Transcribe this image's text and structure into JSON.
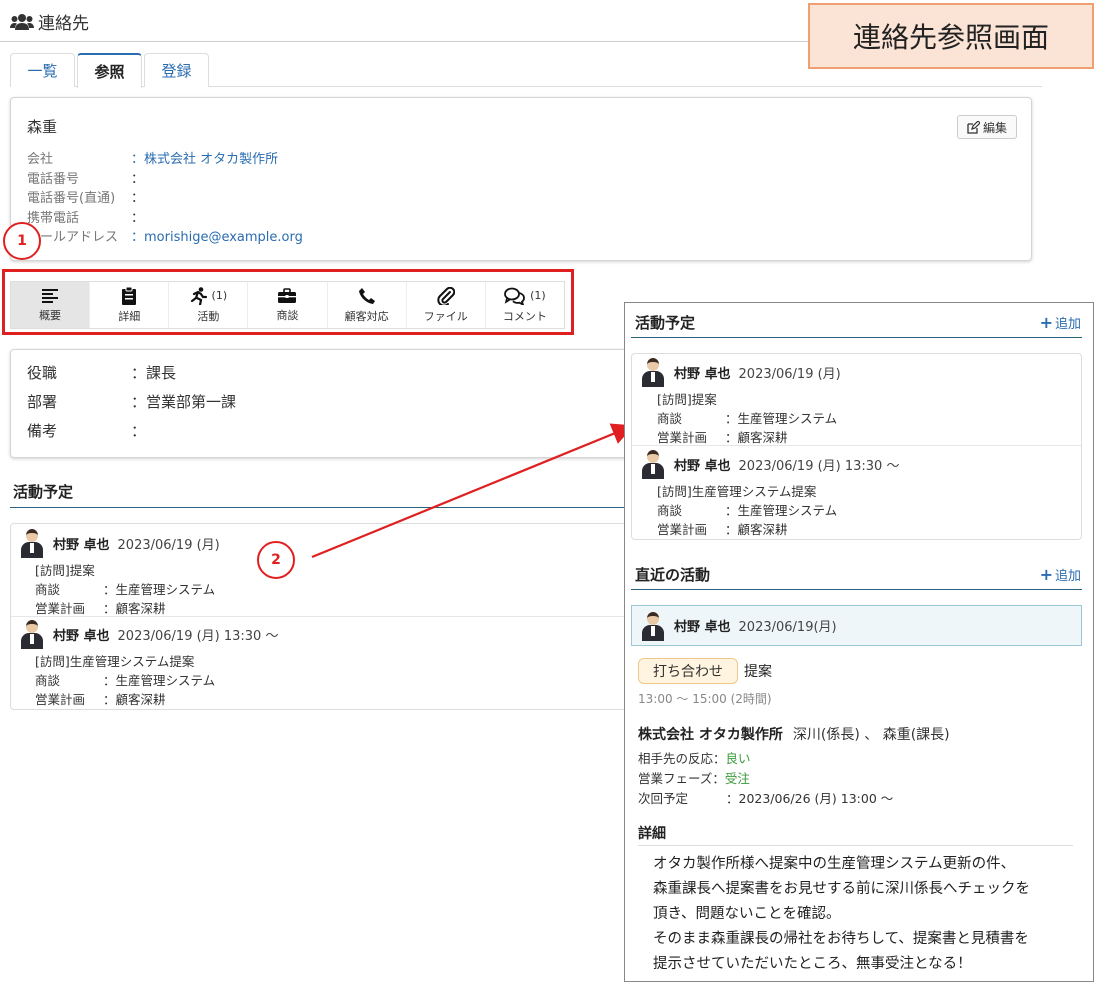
{
  "header": {
    "title": "連絡先"
  },
  "banner": {
    "text": "連絡先参照画面"
  },
  "tabs": [
    {
      "label": "一覧"
    },
    {
      "label": "参照"
    },
    {
      "label": "登録"
    }
  ],
  "contact": {
    "name": "森重",
    "edit_label": "編集",
    "fields": [
      {
        "label": "会社",
        "value": "：株式会社 オタカ製作所"
      },
      {
        "label": "電話番号",
        "value": "："
      },
      {
        "label": "電話番号(直通)",
        "value": "："
      },
      {
        "label": "携帯電話",
        "value": "："
      },
      {
        "label": "メールアドレス",
        "value": "：morishige@example.org"
      }
    ]
  },
  "toolbar": [
    {
      "icon": "list-icon",
      "label": "概要",
      "count": ""
    },
    {
      "icon": "clipboard-icon",
      "label": "詳細",
      "count": ""
    },
    {
      "icon": "running-icon",
      "label": "活動",
      "count": "(1)"
    },
    {
      "icon": "briefcase-icon",
      "label": "商談",
      "count": ""
    },
    {
      "icon": "phone-icon",
      "label": "顧客対応",
      "count": ""
    },
    {
      "icon": "paperclip-icon",
      "label": "ファイル",
      "count": ""
    },
    {
      "icon": "comments-icon",
      "label": "コメント",
      "count": "(1)"
    }
  ],
  "overview": [
    {
      "label": "役職",
      "value": "：課長"
    },
    {
      "label": "部署",
      "value": "：営業部第一課"
    },
    {
      "label": "備考",
      "value": "："
    }
  ],
  "schedule": {
    "title": "活動予定",
    "add_label": "追加",
    "entries": [
      {
        "who": "村野 卓也",
        "when": "2023/06/19 (月)",
        "subject": "[訪問]提案",
        "deal_label": "商談",
        "deal": "：生産管理システム",
        "plan_label": "営業計画",
        "plan": "：顧客深耕"
      },
      {
        "who": "村野 卓也",
        "when": "2023/06/19 (月) 13:30 ～",
        "subject": "[訪問]生産管理システム提案",
        "deal_label": "商談",
        "deal": "：生産管理システム",
        "plan_label": "営業計画",
        "plan": "：顧客深耕"
      }
    ]
  },
  "recent": {
    "title": "直近の活動",
    "add_label": "追加",
    "who": "村野 卓也",
    "when": "2023/06/19(月)",
    "type": "打ち合わせ",
    "subject": "提案",
    "time": "13:00 ～ 15:00 (2時間)",
    "company": "株式会社 オタカ製作所",
    "attendees": "深川(係長) 、 森重(課長)",
    "reaction_label": "相手先の反応：",
    "reaction": "良い",
    "phase_label": "営業フェーズ：",
    "phase": "受注",
    "next_label": "次回予定",
    "next": "：2023/06/26 (月) 13:00 ～",
    "detail_title": "詳細",
    "detail_lines": [
      "オタカ製作所様へ提案中の生産管理システム更新の件、",
      "森重課長へ提案書をお見せする前に深川係長へチェックを",
      "頂き、問題ないことを確認。",
      "そのまま森重課長の帰社をお待ちして、提案書と見積書を",
      "提示させていただいたところ、無事受注となる！"
    ]
  },
  "callouts": [
    "1",
    "2"
  ],
  "colors": {
    "accent": "#2a6cb0",
    "highlight": "#e02020",
    "banner_bg": "#fbe4d5",
    "banner_border": "#f0a070"
  }
}
